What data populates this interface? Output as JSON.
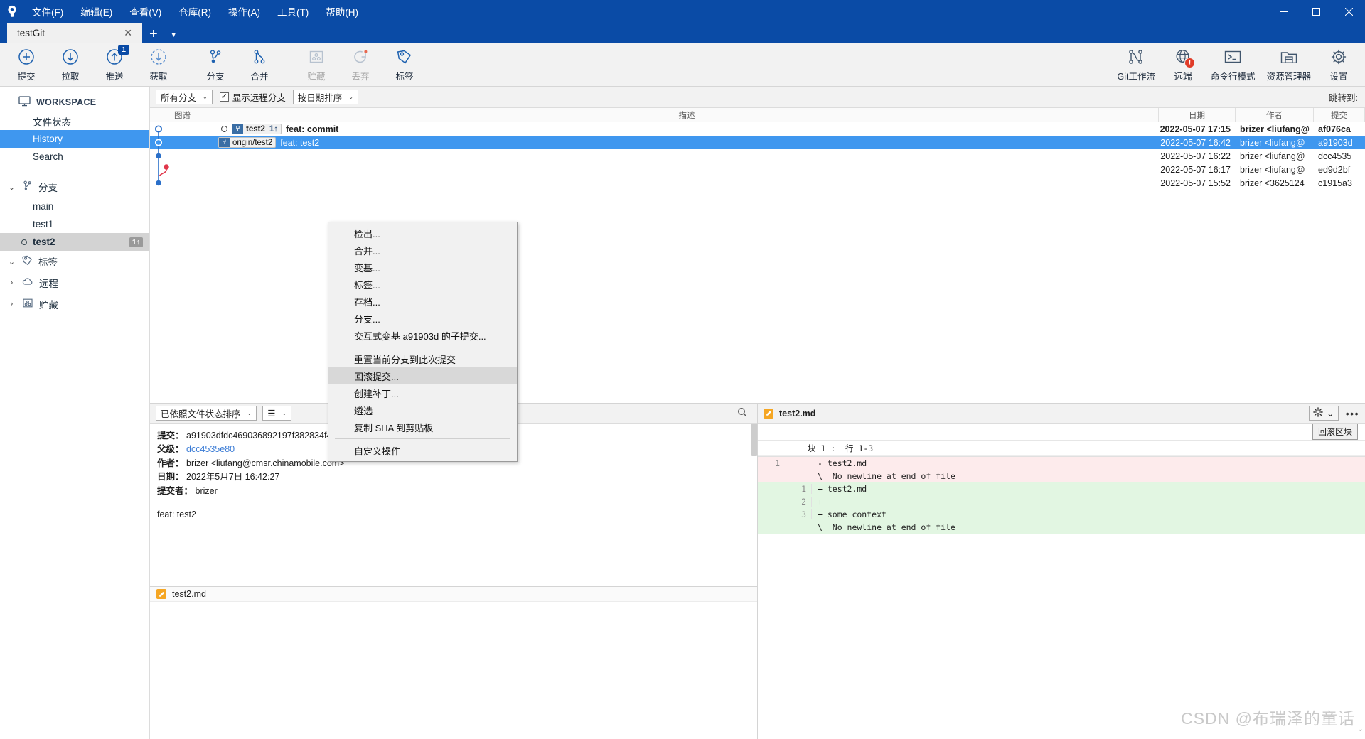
{
  "window": {
    "app_icon": "sourcetree-logo-icon",
    "menus": [
      "文件(F)",
      "编辑(E)",
      "查看(V)",
      "仓库(R)",
      "操作(A)",
      "工具(T)",
      "帮助(H)"
    ],
    "controls": {
      "minimize": "—",
      "maximize": "▢",
      "close": "✕"
    }
  },
  "tabs": {
    "active": "testGit",
    "close_label": "✕",
    "add_label": "+",
    "dropdown_label": "▼"
  },
  "toolbar": {
    "left": [
      {
        "label": "提交",
        "icon": "commit-plus-icon",
        "disabled": false,
        "badge": ""
      },
      {
        "label": "拉取",
        "icon": "pull-down-arrow-icon",
        "disabled": false,
        "badge": ""
      },
      {
        "label": "推送",
        "icon": "push-up-arrow-icon",
        "disabled": false,
        "badge": "1"
      },
      {
        "label": "获取",
        "icon": "fetch-dashed-arrow-icon",
        "disabled": false,
        "badge": ""
      },
      {
        "label": "分支",
        "icon": "branch-icon",
        "disabled": false,
        "badge": ""
      },
      {
        "label": "合并",
        "icon": "merge-icon",
        "disabled": false,
        "badge": ""
      },
      {
        "label": "贮藏",
        "icon": "stash-icon",
        "disabled": true,
        "badge": ""
      },
      {
        "label": "丢弃",
        "icon": "discard-icon",
        "disabled": true,
        "badge": ""
      },
      {
        "label": "标签",
        "icon": "tag-icon",
        "disabled": false,
        "badge": ""
      }
    ],
    "right": [
      {
        "label": "Git工作流",
        "icon": "gitflow-icon",
        "error": false
      },
      {
        "label": "远端",
        "icon": "remote-globe-icon",
        "error": true
      },
      {
        "label": "命令行模式",
        "icon": "terminal-icon",
        "error": false
      },
      {
        "label": "资源管理器",
        "icon": "explorer-folder-icon",
        "error": false
      },
      {
        "label": "设置",
        "icon": "gear-icon",
        "error": false
      }
    ]
  },
  "sidebar": {
    "workspace_label": "WORKSPACE",
    "workspace_icon": "monitor-icon",
    "items": [
      {
        "label": "文件状态",
        "active": false
      },
      {
        "label": "History",
        "active": true
      },
      {
        "label": "Search",
        "active": false
      }
    ],
    "groups": [
      {
        "label": "分支",
        "icon": "branch-icon",
        "expanded": true,
        "caret": "⌄",
        "branches": [
          {
            "name": "main",
            "current": false,
            "badge": ""
          },
          {
            "name": "test1",
            "current": false,
            "badge": ""
          },
          {
            "name": "test2",
            "current": true,
            "badge": "1↑"
          }
        ]
      },
      {
        "label": "标签",
        "icon": "tag-icon",
        "expanded": true,
        "caret": "⌄",
        "branches": []
      },
      {
        "label": "远程",
        "icon": "cloud-icon",
        "expanded": false,
        "caret": "›",
        "branches": []
      },
      {
        "label": "贮藏",
        "icon": "stash-icon",
        "expanded": false,
        "caret": "›",
        "branches": []
      }
    ]
  },
  "filterbar": {
    "branch_filter": {
      "value": "所有分支",
      "caret": "⌄"
    },
    "show_remote": {
      "label": "显示远程分支",
      "checked": true,
      "check_glyph": "✓"
    },
    "sort": {
      "value": "按日期排序",
      "caret": "⌄"
    },
    "jump_to_label": "跳转到:"
  },
  "commit_table": {
    "columns": [
      "图谱",
      "描述",
      "日期",
      "作者",
      "提交"
    ],
    "rows": [
      {
        "refs": [
          {
            "text": "test2",
            "ahead": "1↑",
            "remote": false
          }
        ],
        "message": "feat: commit",
        "date": "2022-05-07 17:15",
        "author": "brizer <liufang@",
        "sha": "af076ca",
        "selected": false,
        "bold": true,
        "has_dot": true
      },
      {
        "refs": [
          {
            "text": "origin/test2",
            "ahead": "",
            "remote": true
          }
        ],
        "message": "feat: test2",
        "date": "2022-05-07 16:42",
        "author": "brizer <liufang@",
        "sha": "a91903d",
        "selected": true,
        "bold": false,
        "has_dot": false
      },
      {
        "refs": [],
        "message": "",
        "date": "2022-05-07 16:22",
        "author": "brizer <liufang@",
        "sha": "dcc4535",
        "selected": false,
        "bold": false,
        "has_dot": false
      },
      {
        "refs": [],
        "message": "",
        "date": "2022-05-07 16:17",
        "author": "brizer <liufang@",
        "sha": "ed9d2bf",
        "selected": false,
        "bold": false,
        "has_dot": false
      },
      {
        "refs": [],
        "message": "",
        "date": "2022-05-07 15:52",
        "author": "brizer <3625124",
        "sha": "c1915a3",
        "selected": false,
        "bold": false,
        "has_dot": false
      }
    ]
  },
  "context_menu": {
    "items": [
      {
        "label": "检出...",
        "highlighted": false,
        "separator_after": false
      },
      {
        "label": "合并...",
        "highlighted": false,
        "separator_after": false
      },
      {
        "label": "变基...",
        "highlighted": false,
        "separator_after": false
      },
      {
        "label": "标签...",
        "highlighted": false,
        "separator_after": false
      },
      {
        "label": "存档...",
        "highlighted": false,
        "separator_after": false
      },
      {
        "label": "分支...",
        "highlighted": false,
        "separator_after": false
      },
      {
        "label": "交互式变基 a91903d 的子提交...",
        "highlighted": false,
        "separator_after": true
      },
      {
        "label": "重置当前分支到此次提交",
        "highlighted": false,
        "separator_after": false
      },
      {
        "label": "回滚提交...",
        "highlighted": true,
        "separator_after": false
      },
      {
        "label": "创建补丁...",
        "highlighted": false,
        "separator_after": false
      },
      {
        "label": "遴选",
        "highlighted": false,
        "separator_after": false
      },
      {
        "label": "复制 SHA 到剪贴板",
        "highlighted": false,
        "separator_after": true
      },
      {
        "label": "自定义操作",
        "highlighted": false,
        "separator_after": false
      }
    ]
  },
  "details_pane": {
    "sort_combo": {
      "value": "已依照文件状态排序",
      "caret": "⌄"
    },
    "view_combo": {
      "value": "☰",
      "caret": "⌄"
    },
    "search_icon": "search-icon",
    "fields": [
      {
        "key": "提交：",
        "value": "a91903dfdc469036892197f382834f4abe17a147 [a91903d]",
        "link": false
      },
      {
        "key": "父级：",
        "value": "dcc4535e80",
        "link": true
      },
      {
        "key": "作者：",
        "value": "brizer <liufang@cmsr.chinamobile.com>",
        "link": false
      },
      {
        "key": "日期：",
        "value": "2022年5月7日 16:42:27",
        "link": false
      },
      {
        "key": "提交者：",
        "value": "brizer",
        "link": false
      }
    ],
    "message": "feat: test2",
    "file_list": [
      {
        "name": "test2.md",
        "status_icon": "modified-pencil-icon"
      }
    ]
  },
  "diff_pane": {
    "file_name": "test2.md",
    "file_icon": "modified-pencil-icon",
    "gear_icon": "gear-icon",
    "gear_caret": "⌄",
    "more_icon": "more-dots-icon",
    "revert_chunk_label": "回滚区块",
    "hunk_header": "块 1 :  行 1-3",
    "lines": [
      {
        "old": "1",
        "new": "",
        "type": "del",
        "text": "- test2.md"
      },
      {
        "old": "",
        "new": "",
        "type": "del",
        "text": "\\  No newline at end of file"
      },
      {
        "old": "",
        "new": "1",
        "type": "add",
        "text": "+ test2.md"
      },
      {
        "old": "",
        "new": "2",
        "type": "add",
        "text": "+"
      },
      {
        "old": "",
        "new": "3",
        "type": "add",
        "text": "+ some context"
      },
      {
        "old": "",
        "new": "",
        "type": "add",
        "text": "\\  No newline at end of file"
      }
    ]
  },
  "watermark": {
    "text": "CSDN @布瑞泽的童话"
  },
  "colors": {
    "title_blue": "#0a4ba6",
    "selection_blue": "#3f97ef",
    "accent_blue": "#1f62b0",
    "error_red": "#e03b28",
    "diff_add": "#e2f6e2",
    "diff_del": "#fdebec",
    "graph_blue": "#2a6fc9",
    "graph_red": "#e0374b",
    "modified_orange": "#f5a623"
  }
}
